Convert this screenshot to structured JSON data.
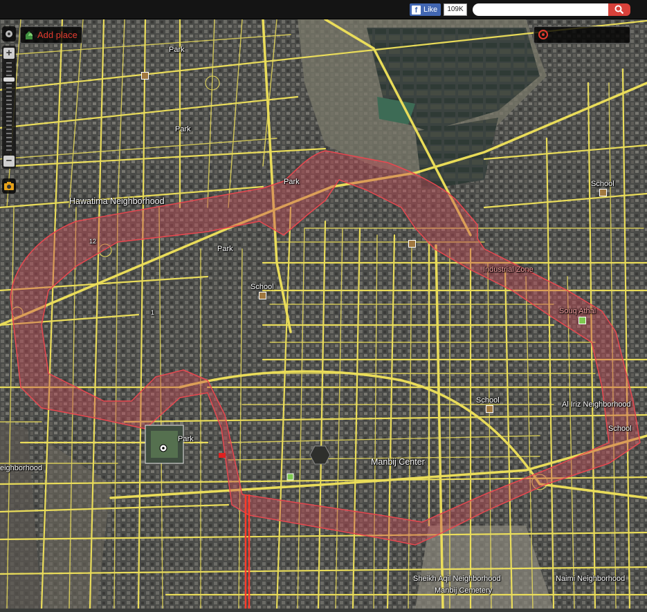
{
  "header": {
    "like_label": "Like",
    "like_count": "109K",
    "search": {
      "value": "",
      "placeholder": ""
    }
  },
  "toolbar": {
    "add_place_label": "Add place"
  },
  "zoom": {
    "plus": "+",
    "minus": "−"
  },
  "map_labels": {
    "park_1": "Park",
    "park_2": "Park",
    "park_3": "Park",
    "park_4": "Park",
    "park_5": "Park",
    "hawatima": "Hawatima Neighborhood",
    "school_1": "School",
    "school_2": "School",
    "school_3": "School",
    "school_4": "School",
    "industrial_zone": "Industrial Zone",
    "souq_athal": "Souq Athal",
    "al_iriz": "Al Iriz Neighborhood",
    "manbij_center": "Manbij Center",
    "sheikh_aqil": "Sheikh Aqil Neighborhood",
    "manbij_cemetery": "Manbij Cemetery",
    "naimi": "Naimi Neighborhood",
    "neighborhood_left": "eighborhood",
    "num_12": "12",
    "num_1": "1"
  },
  "colors": {
    "road": "#f2e45a",
    "highlight_fill": "#c84a55",
    "highlight_stroke": "#e8474f",
    "search_button": "#d9413a",
    "add_place_text": "#e33a2e"
  },
  "icons": [
    "search-icon",
    "add-place-icon",
    "target-icon",
    "zoom-in-icon",
    "zoom-out-icon",
    "camera-icon",
    "soccer-ball-icon"
  ]
}
